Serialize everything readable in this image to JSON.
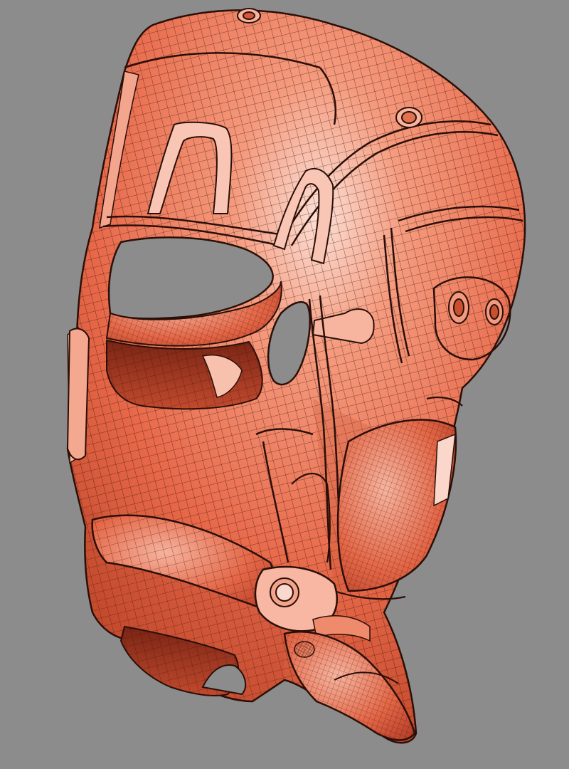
{
  "scene": {
    "background_color": "#8c8c8c",
    "model": "wireframe-mask-3d-render",
    "surface_color": "#ef7a5a",
    "highlight_color": "#fbd0c2",
    "shadow_color": "#b83a1e",
    "wire_color": "#2a0f08"
  }
}
